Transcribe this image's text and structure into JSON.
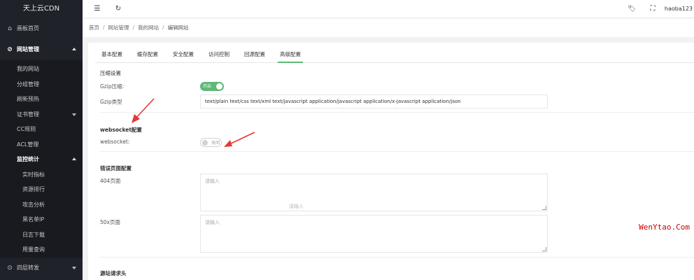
{
  "app": {
    "logo": "天上云CDN"
  },
  "sidebar": {
    "dashboard": {
      "label": "画板首页",
      "icon": "home-icon"
    },
    "site_mgmt": {
      "label": "网站管理",
      "icon": "globe-icon"
    },
    "site_items": [
      {
        "label": "我的网站"
      },
      {
        "label": "分组管理"
      },
      {
        "label": "刷新预热"
      },
      {
        "label": "证书管理"
      },
      {
        "label": "CC规则"
      },
      {
        "label": "ACL管理"
      },
      {
        "label": "监控统计"
      }
    ],
    "monitor_items": [
      {
        "label": "实时指标"
      },
      {
        "label": "资源排行"
      },
      {
        "label": "攻击分析"
      },
      {
        "label": "黑名单IP"
      },
      {
        "label": "日志下载"
      },
      {
        "label": "用量查询"
      }
    ],
    "forward": {
      "label": "四层转发",
      "icon": "forward-icon"
    }
  },
  "topbar": {
    "menu_icon": "☰",
    "refresh_icon": "↻",
    "tag_icon": "🏷",
    "fullscreen_icon": "⛶",
    "username": "haoba123"
  },
  "breadcrumb": {
    "items": [
      "首页",
      "网站管理",
      "我的网站",
      "编辑网站"
    ]
  },
  "tabs": [
    {
      "label": "基本配置"
    },
    {
      "label": "缓存配置"
    },
    {
      "label": "安全配置"
    },
    {
      "label": "访问控制"
    },
    {
      "label": "回源配置"
    },
    {
      "label": "高级配置"
    }
  ],
  "active_tab": "高级配置",
  "compress": {
    "title": "压缩设置",
    "gzip_label": "Gzip压缩:",
    "gzip_switch": "开启",
    "gzip_type_label": "Gzip类型",
    "gzip_type_value": "text/plain text/css text/xml text/javascript application/javascript application/x-javascript application/json"
  },
  "websocket": {
    "title": "websocket配置",
    "label": "websocket:",
    "switch": "关闭"
  },
  "error_pages": {
    "title": "错误页面配置",
    "p404_label": "404页面",
    "p404_placeholder": "请输入",
    "p50x_label": "50x页面",
    "p50x_placeholder": "请输入",
    "ghost_text": "请输入"
  },
  "origin_headers": {
    "title": "源站请求头"
  },
  "watermark": "WenYtao.Com",
  "colors": {
    "sidebar_bg": "#20222a",
    "accent": "#5fb878",
    "arrow": "#e53935"
  }
}
